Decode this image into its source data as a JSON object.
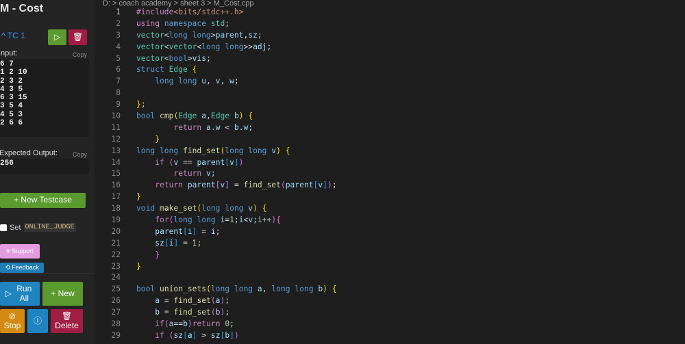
{
  "sidebar": {
    "title": "M - Cost",
    "testcase": {
      "label": "TC 1",
      "input_label": "Input:",
      "copy": "Copy",
      "input": "6 7\n1 2 10\n2 3 2\n4 3 5\n6 3 15\n3 5 4\n4 5 3\n2 6 6",
      "expected_label": "Expected Output:",
      "expected": "256"
    },
    "new_testcase": "New Testcase",
    "set_label": "Set",
    "online_judge": "ONLINE_JUDGE",
    "support": "Support",
    "feedback": "Feedback",
    "run_all": "Run All",
    "new": "New",
    "stop": "Stop",
    "delete": "Delete"
  },
  "editor": {
    "breadcrumb": "D: > coach academy > sheet 3 > M_Cost.cpp",
    "lines": [
      [
        [
          "#include",
          "k"
        ],
        [
          "<bits/stdc++.h>",
          "str"
        ]
      ],
      [
        [
          "using",
          "k"
        ],
        [
          " ",
          "p"
        ],
        [
          "namespace",
          "t"
        ],
        [
          " ",
          "p"
        ],
        [
          "std",
          "s"
        ],
        [
          ";",
          "p"
        ]
      ],
      [
        [
          "vector",
          "s"
        ],
        [
          "<",
          "p"
        ],
        [
          "long long",
          "t"
        ],
        [
          ">",
          "p"
        ],
        [
          "parent",
          "v"
        ],
        [
          ",",
          "p"
        ],
        [
          "sz",
          "v"
        ],
        [
          ";",
          "p"
        ]
      ],
      [
        [
          "vector",
          "s"
        ],
        [
          "<",
          "p"
        ],
        [
          "vector",
          "s"
        ],
        [
          "<",
          "p"
        ],
        [
          "long long",
          "t"
        ],
        [
          ">>",
          "p"
        ],
        [
          "adj",
          "v"
        ],
        [
          ";",
          "p"
        ]
      ],
      [
        [
          "vector",
          "s"
        ],
        [
          "<",
          "p"
        ],
        [
          "bool",
          "t"
        ],
        [
          ">",
          "p"
        ],
        [
          "vis",
          "v"
        ],
        [
          ";",
          "p"
        ]
      ],
      [
        [
          "struct",
          "t"
        ],
        [
          " ",
          "p"
        ],
        [
          "Edge",
          "s"
        ],
        [
          " ",
          "p"
        ],
        [
          "{",
          "b1"
        ]
      ],
      [
        [
          "    ",
          "p"
        ],
        [
          "long long",
          "t"
        ],
        [
          " ",
          "p"
        ],
        [
          "u",
          "v"
        ],
        [
          ", ",
          "p"
        ],
        [
          "v",
          "v"
        ],
        [
          ", ",
          "p"
        ],
        [
          "w",
          "v"
        ],
        [
          ";",
          "p"
        ]
      ],
      [],
      [
        [
          "}",
          "b1"
        ],
        [
          ";",
          "p"
        ]
      ],
      [
        [
          "bool",
          "t"
        ],
        [
          " ",
          "p"
        ],
        [
          "cmp",
          "f"
        ],
        [
          "(",
          "b1"
        ],
        [
          "Edge",
          "s"
        ],
        [
          " ",
          "p"
        ],
        [
          "a",
          "v"
        ],
        [
          ",",
          "p"
        ],
        [
          "Edge",
          "s"
        ],
        [
          " ",
          "p"
        ],
        [
          "b",
          "v"
        ],
        [
          ")",
          "b1"
        ],
        [
          " ",
          "p"
        ],
        [
          "{",
          "b1"
        ]
      ],
      [
        [
          "        ",
          "p"
        ],
        [
          "return",
          "k"
        ],
        [
          " ",
          "p"
        ],
        [
          "a",
          "v"
        ],
        [
          ".",
          "p"
        ],
        [
          "w",
          "v"
        ],
        [
          " < ",
          "p"
        ],
        [
          "b",
          "v"
        ],
        [
          ".",
          "p"
        ],
        [
          "w",
          "v"
        ],
        [
          ";",
          "p"
        ]
      ],
      [
        [
          "    ",
          "p"
        ],
        [
          "}",
          "b1"
        ]
      ],
      [
        [
          "long long",
          "t"
        ],
        [
          " ",
          "p"
        ],
        [
          "find_set",
          "f"
        ],
        [
          "(",
          "b1"
        ],
        [
          "long long",
          "t"
        ],
        [
          " ",
          "p"
        ],
        [
          "v",
          "v"
        ],
        [
          ")",
          "b1"
        ],
        [
          " ",
          "p"
        ],
        [
          "{",
          "b1"
        ]
      ],
      [
        [
          "    ",
          "p"
        ],
        [
          "if",
          "k"
        ],
        [
          " ",
          "p"
        ],
        [
          "(",
          "b2"
        ],
        [
          "v",
          "v"
        ],
        [
          " == ",
          "p"
        ],
        [
          "parent",
          "v"
        ],
        [
          "[",
          "b3"
        ],
        [
          "v",
          "v"
        ],
        [
          "]",
          "b3"
        ],
        [
          ")",
          "b2"
        ]
      ],
      [
        [
          "        ",
          "p"
        ],
        [
          "return",
          "k"
        ],
        [
          " ",
          "p"
        ],
        [
          "v",
          "v"
        ],
        [
          ";",
          "p"
        ]
      ],
      [
        [
          "    ",
          "p"
        ],
        [
          "return",
          "k"
        ],
        [
          " ",
          "p"
        ],
        [
          "parent",
          "v"
        ],
        [
          "[",
          "b2"
        ],
        [
          "v",
          "v"
        ],
        [
          "]",
          "b2"
        ],
        [
          " = ",
          "p"
        ],
        [
          "find_set",
          "f"
        ],
        [
          "(",
          "b2"
        ],
        [
          "parent",
          "v"
        ],
        [
          "[",
          "b3"
        ],
        [
          "v",
          "v"
        ],
        [
          "]",
          "b3"
        ],
        [
          ")",
          "b2"
        ],
        [
          ";",
          "p"
        ]
      ],
      [
        [
          "}",
          "b1"
        ]
      ],
      [
        [
          "void",
          "t"
        ],
        [
          " ",
          "p"
        ],
        [
          "make_set",
          "f"
        ],
        [
          "(",
          "b1"
        ],
        [
          "long long",
          "t"
        ],
        [
          " ",
          "p"
        ],
        [
          "v",
          "v"
        ],
        [
          ")",
          "b1"
        ],
        [
          " ",
          "p"
        ],
        [
          "{",
          "b1"
        ]
      ],
      [
        [
          "    ",
          "p"
        ],
        [
          "for",
          "k"
        ],
        [
          "(",
          "b2"
        ],
        [
          "long long",
          "t"
        ],
        [
          " ",
          "p"
        ],
        [
          "i",
          "v"
        ],
        [
          "=",
          "p"
        ],
        [
          "1",
          "n"
        ],
        [
          ";",
          "p"
        ],
        [
          "i",
          "v"
        ],
        [
          "<",
          "p"
        ],
        [
          "v",
          "v"
        ],
        [
          ";",
          "p"
        ],
        [
          "i",
          "v"
        ],
        [
          "++",
          "p"
        ],
        [
          ")",
          "b2"
        ],
        [
          "{",
          "b2"
        ]
      ],
      [
        [
          "    ",
          "p"
        ],
        [
          "parent",
          "v"
        ],
        [
          "[",
          "b3"
        ],
        [
          "i",
          "v"
        ],
        [
          "]",
          "b3"
        ],
        [
          " = ",
          "p"
        ],
        [
          "i",
          "v"
        ],
        [
          ";",
          "p"
        ]
      ],
      [
        [
          "    ",
          "p"
        ],
        [
          "sz",
          "v"
        ],
        [
          "[",
          "b3"
        ],
        [
          "i",
          "v"
        ],
        [
          "]",
          "b3"
        ],
        [
          " = ",
          "p"
        ],
        [
          "1",
          "n"
        ],
        [
          ";",
          "p"
        ]
      ],
      [
        [
          "    ",
          "p"
        ],
        [
          "}",
          "b2"
        ]
      ],
      [
        [
          "}",
          "b1"
        ]
      ],
      [],
      [
        [
          "bool",
          "t"
        ],
        [
          " ",
          "p"
        ],
        [
          "union_sets",
          "f"
        ],
        [
          "(",
          "b1"
        ],
        [
          "long long",
          "t"
        ],
        [
          " ",
          "p"
        ],
        [
          "a",
          "v"
        ],
        [
          ", ",
          "p"
        ],
        [
          "long long",
          "t"
        ],
        [
          " ",
          "p"
        ],
        [
          "b",
          "v"
        ],
        [
          ")",
          "b1"
        ],
        [
          " ",
          "p"
        ],
        [
          "{",
          "b1"
        ]
      ],
      [
        [
          "    ",
          "p"
        ],
        [
          "a",
          "v"
        ],
        [
          " = ",
          "p"
        ],
        [
          "find_set",
          "f"
        ],
        [
          "(",
          "b2"
        ],
        [
          "a",
          "v"
        ],
        [
          ")",
          "b2"
        ],
        [
          ";",
          "p"
        ]
      ],
      [
        [
          "    ",
          "p"
        ],
        [
          "b",
          "v"
        ],
        [
          " = ",
          "p"
        ],
        [
          "find_set",
          "f"
        ],
        [
          "(",
          "b2"
        ],
        [
          "b",
          "v"
        ],
        [
          ")",
          "b2"
        ],
        [
          ";",
          "p"
        ]
      ],
      [
        [
          "    ",
          "p"
        ],
        [
          "if",
          "k"
        ],
        [
          "(",
          "b2"
        ],
        [
          "a",
          "v"
        ],
        [
          "==",
          "p"
        ],
        [
          "b",
          "v"
        ],
        [
          ")",
          "b2"
        ],
        [
          "return",
          "k"
        ],
        [
          " ",
          "p"
        ],
        [
          "0",
          "n"
        ],
        [
          ";",
          "p"
        ]
      ],
      [
        [
          "    ",
          "p"
        ],
        [
          "if",
          "k"
        ],
        [
          " ",
          "p"
        ],
        [
          "(",
          "b2"
        ],
        [
          "sz",
          "v"
        ],
        [
          "[",
          "b3"
        ],
        [
          "a",
          "v"
        ],
        [
          "]",
          "b3"
        ],
        [
          " > ",
          "p"
        ],
        [
          "sz",
          "v"
        ],
        [
          "[",
          "b3"
        ],
        [
          "b",
          "v"
        ],
        [
          "]",
          "b3"
        ],
        [
          ")",
          "b2"
        ]
      ]
    ]
  }
}
